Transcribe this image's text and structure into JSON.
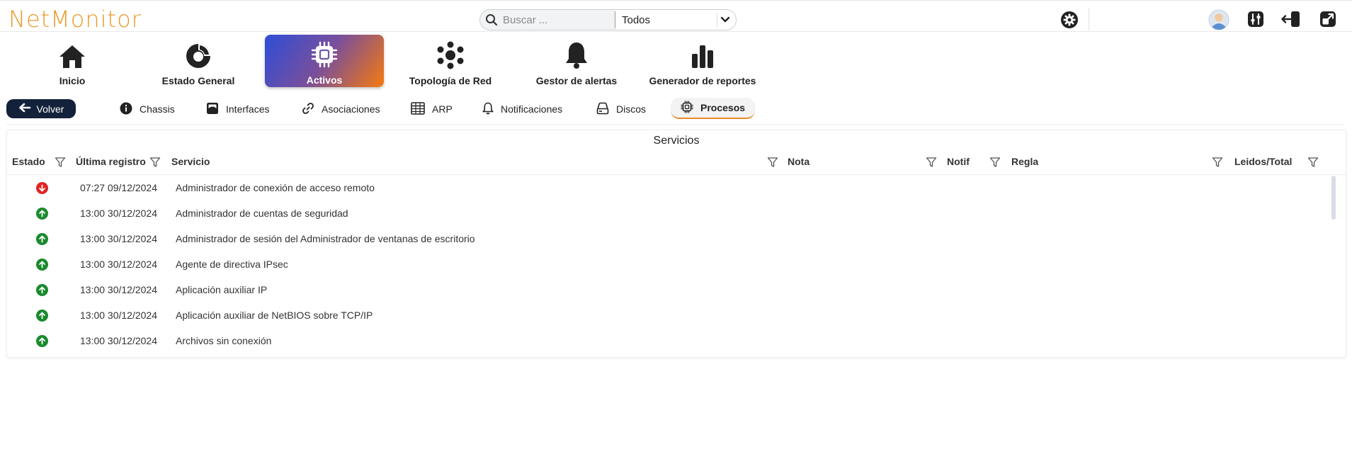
{
  "app": {
    "logo": "NetMonitor"
  },
  "search": {
    "placeholder": "Buscar ...",
    "value": "",
    "filter_value": "Todos"
  },
  "nav": {
    "items": [
      {
        "label": "Inicio",
        "icon": "home-icon"
      },
      {
        "label": "Estado General",
        "icon": "gauge-icon"
      },
      {
        "label": "Activos",
        "icon": "chip-icon",
        "active": true
      },
      {
        "label": "Topología de Red",
        "icon": "network-icon"
      },
      {
        "label": "Gestor de alertas",
        "icon": "bell-icon"
      },
      {
        "label": "Generador de reportes",
        "icon": "bar-chart-icon"
      }
    ]
  },
  "subnav": {
    "back_label": "Volver",
    "tabs": [
      {
        "label": "Chassis",
        "icon": "info-icon"
      },
      {
        "label": "Interfaces",
        "icon": "interface-icon"
      },
      {
        "label": "Asociaciones",
        "icon": "link-icon"
      },
      {
        "label": "ARP",
        "icon": "table-icon"
      },
      {
        "label": "Notificaciones",
        "icon": "bell-icon"
      },
      {
        "label": "Discos",
        "icon": "disk-icon"
      },
      {
        "label": "Procesos",
        "icon": "cpu-icon",
        "active": true
      }
    ]
  },
  "services": {
    "title": "Servicios",
    "columns": {
      "estado": "Estado",
      "ultimo": "Última registro",
      "servicio": "Servicio",
      "nota": "Nota",
      "notif": "Notif",
      "regla": "Regla",
      "leidos": "Leidos/Total"
    },
    "rows": [
      {
        "status": "down",
        "date": "07:27 09/12/2024",
        "service": "Administrador de conexión de acceso remoto"
      },
      {
        "status": "up",
        "date": "13:00 30/12/2024",
        "service": "Administrador de cuentas de seguridad"
      },
      {
        "status": "up",
        "date": "13:00 30/12/2024",
        "service": "Administrador de sesión del Administrador de ventanas de escritorio"
      },
      {
        "status": "up",
        "date": "13:00 30/12/2024",
        "service": "Agente de directiva IPsec"
      },
      {
        "status": "up",
        "date": "13:00 30/12/2024",
        "service": "Aplicación auxiliar IP"
      },
      {
        "status": "up",
        "date": "13:00 30/12/2024",
        "service": "Aplicación auxiliar de NetBIOS sobre TCP/IP"
      },
      {
        "status": "up",
        "date": "13:00 30/12/2024",
        "service": "Archivos sin conexión"
      }
    ]
  },
  "colors": {
    "accent": "#e99a2c",
    "up": "#1a8a2e",
    "down": "#e02424",
    "back_button": "#13213a",
    "active_gradient_start": "#2d4ed8",
    "active_gradient_end": "#f57a0e"
  }
}
